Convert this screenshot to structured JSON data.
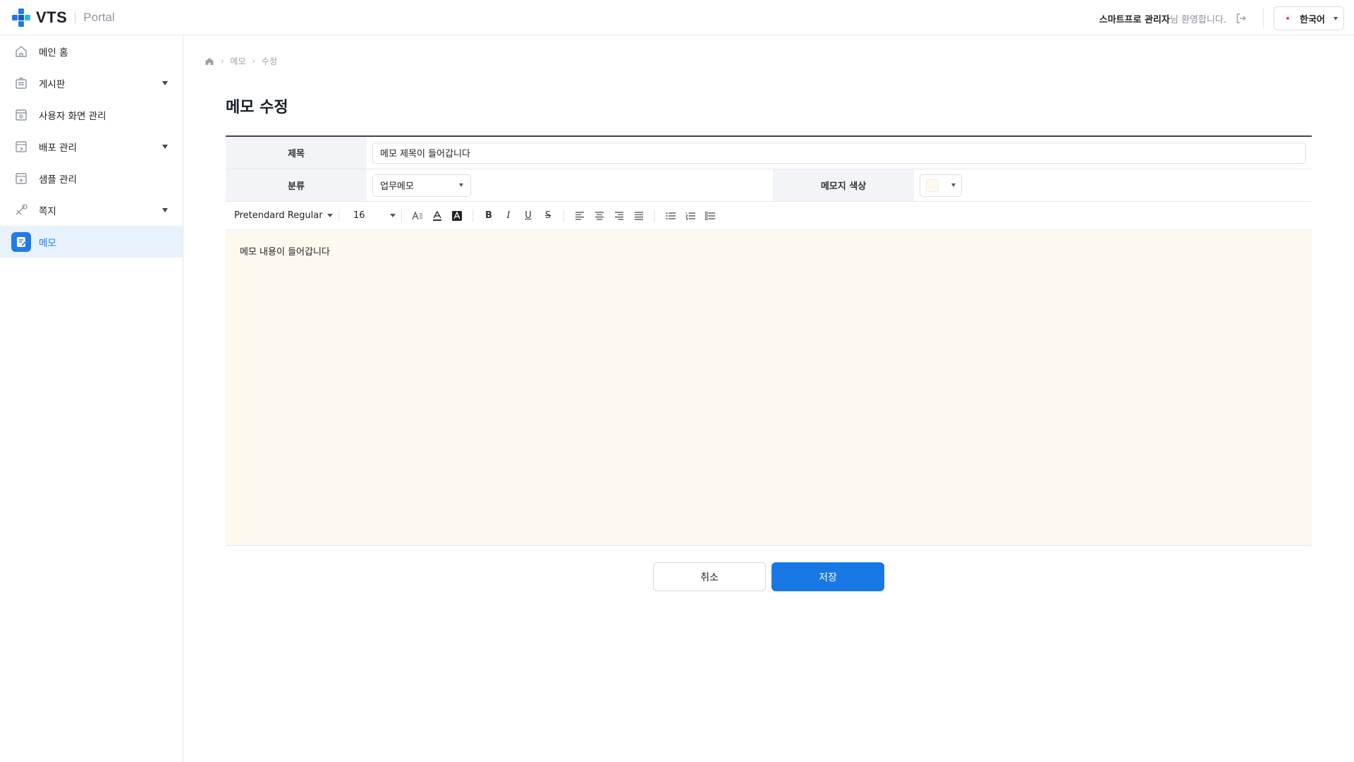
{
  "header": {
    "logo_text": "VTS",
    "logo_sub": "Portal",
    "user_name": "스마트프로 관리자",
    "welcome_suffix": "님 환영합니다.",
    "language": "한국어"
  },
  "sidebar": {
    "items": [
      {
        "label": "메인 홈",
        "icon": "home-icon",
        "has_submenu": false,
        "active": false
      },
      {
        "label": "게시판",
        "icon": "board-icon",
        "has_submenu": true,
        "active": false
      },
      {
        "label": "사용자 화면 관리",
        "icon": "screen-manage-icon",
        "has_submenu": false,
        "active": false
      },
      {
        "label": "배포 관리",
        "icon": "deploy-icon",
        "has_submenu": true,
        "active": false
      },
      {
        "label": "샘플 관리",
        "icon": "sample-icon",
        "has_submenu": false,
        "active": false
      },
      {
        "label": "쪽지",
        "icon": "note-icon",
        "has_submenu": true,
        "active": false
      },
      {
        "label": "메모",
        "icon": "memo-icon",
        "has_submenu": false,
        "active": true
      }
    ]
  },
  "breadcrumb": [
    "메모",
    "수정"
  ],
  "page_title": "메모 수정",
  "form": {
    "title_label": "제목",
    "title_value": "메모 제목이 들어갑니다",
    "category_label": "분류",
    "category_value": "업무메모",
    "color_label": "메모지 색상",
    "color_value": "#fdf9ef"
  },
  "toolbar": {
    "font_family": "Pretendard Regular",
    "font_size": "16"
  },
  "editor": {
    "content": "메모 내용이 들어갑니다",
    "background": "#fdf9ef"
  },
  "buttons": {
    "cancel": "취소",
    "save": "저장"
  },
  "colors": {
    "accent": "#1778e6",
    "active_nav_bg": "#e8f2fd"
  }
}
